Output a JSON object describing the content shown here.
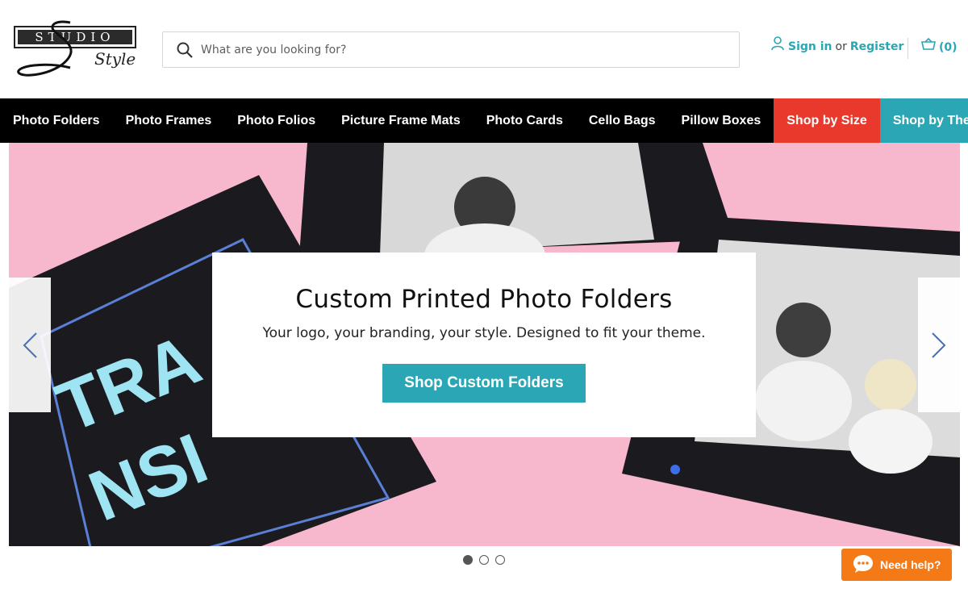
{
  "brand": {
    "logo_top": "STUDIO",
    "logo_script": "Style"
  },
  "search": {
    "placeholder": "What are you looking for?",
    "icon": "search-icon"
  },
  "account": {
    "icon": "user-icon",
    "sign_in": "Sign in",
    "or": "or",
    "register": "Register"
  },
  "cart": {
    "icon": "basket-icon",
    "count": "(0)"
  },
  "nav": {
    "items": [
      {
        "label": "Photo Folders"
      },
      {
        "label": "Photo Frames"
      },
      {
        "label": "Photo Folios"
      },
      {
        "label": "Picture Frame Mats"
      },
      {
        "label": "Photo Cards"
      },
      {
        "label": "Cello Bags"
      },
      {
        "label": "Pillow Boxes"
      },
      {
        "label": "Shop by Size"
      },
      {
        "label": "Shop by Theme"
      }
    ]
  },
  "hero": {
    "title": "Custom Printed Photo Folders",
    "subtitle": "Your logo, your branding, your style. Designed to fit your theme.",
    "cta": "Shop Custom Folders",
    "folder_text_1": "TRA",
    "folder_text_2": "NSI",
    "prev_icon": "chevron-left-icon",
    "next_icon": "chevron-right-icon"
  },
  "carousel": {
    "slides": 3,
    "active": 1
  },
  "help": {
    "label": "Need help?",
    "icon": "chat-bubble-icon"
  },
  "colors": {
    "teal": "#2aa6b4",
    "red": "#e8392c",
    "orange": "#f47a17",
    "nav_bg": "#000000",
    "hero_pink": "#f7b7cc"
  }
}
